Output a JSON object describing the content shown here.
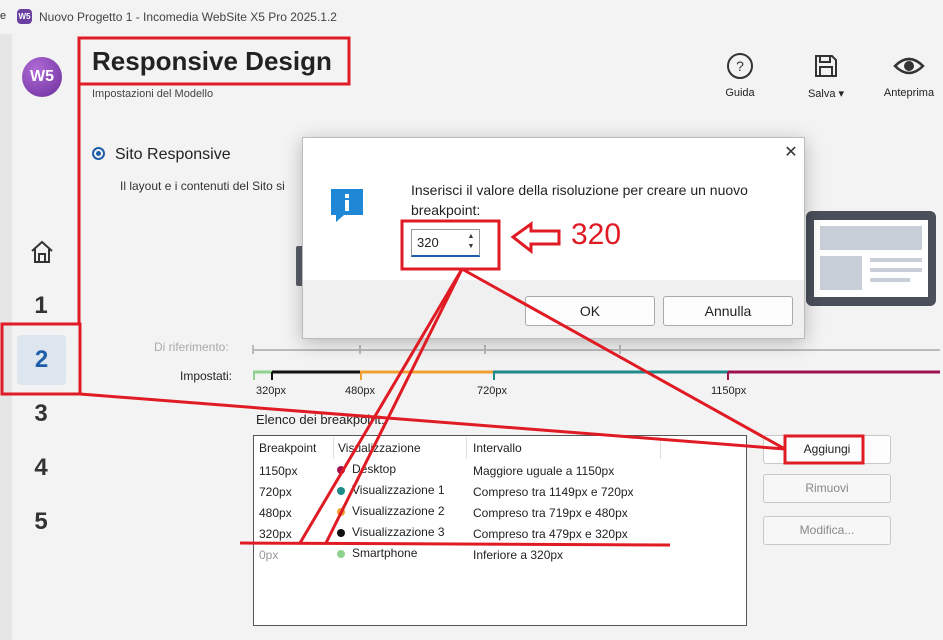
{
  "window": {
    "edge_char": "e",
    "app_icon_text": "W5",
    "title": "Nuovo Progetto 1 - Incomedia WebSite X5 Pro 2025.1.2"
  },
  "sidebar": {
    "logo_text": "W5",
    "steps": [
      "1",
      "2",
      "3",
      "4",
      "5"
    ],
    "selected_step": "2"
  },
  "header": {
    "title": "Responsive Design",
    "subtitle": "Impostazioni del Modello"
  },
  "toolbar": {
    "help_label": "Guida",
    "save_label": "Salva ▾",
    "preview_label": "Anteprima"
  },
  "section": {
    "radio_label": "Sito Responsive",
    "description": "Il layout e i contenuti del Sito si"
  },
  "ruler": {
    "reference_label": "Di riferimento:",
    "set_label": "Impostati:",
    "ticks": [
      "320px",
      "480px",
      "720px",
      "1150px"
    ]
  },
  "breakpoints": {
    "list_label": "Elenco dei breakpoint:",
    "columns": [
      "Breakpoint",
      "Visualizzazione",
      "Intervallo"
    ],
    "rows": [
      {
        "bp": "1150px",
        "view": "Desktop",
        "range": "Maggiore uguale a 1150px",
        "color": "#a0124f"
      },
      {
        "bp": "720px",
        "view": "Visualizzazione 1",
        "range": "Compreso tra 1149px e 720px",
        "color": "#1f8a8a"
      },
      {
        "bp": "480px",
        "view": "Visualizzazione 2",
        "range": "Compreso tra 719px e 480px",
        "color": "#f0a030"
      },
      {
        "bp": "320px",
        "view": "Visualizzazione 3",
        "range": "Compreso tra 479px e 320px",
        "color": "#111111"
      },
      {
        "bp": "0px",
        "view": "Smartphone",
        "range": "Inferiore a 320px",
        "color": "#8fd18f"
      }
    ]
  },
  "actions": {
    "add": "Aggiungi",
    "remove": "Rimuovi",
    "edit": "Modifica..."
  },
  "dialog": {
    "prompt": "Inserisci il valore della risoluzione per creare un nuovo breakpoint:",
    "value": "320",
    "ok": "OK",
    "cancel": "Annulla",
    "close": "✕"
  },
  "annotation": {
    "text": "320",
    "color": "#e01b24"
  }
}
